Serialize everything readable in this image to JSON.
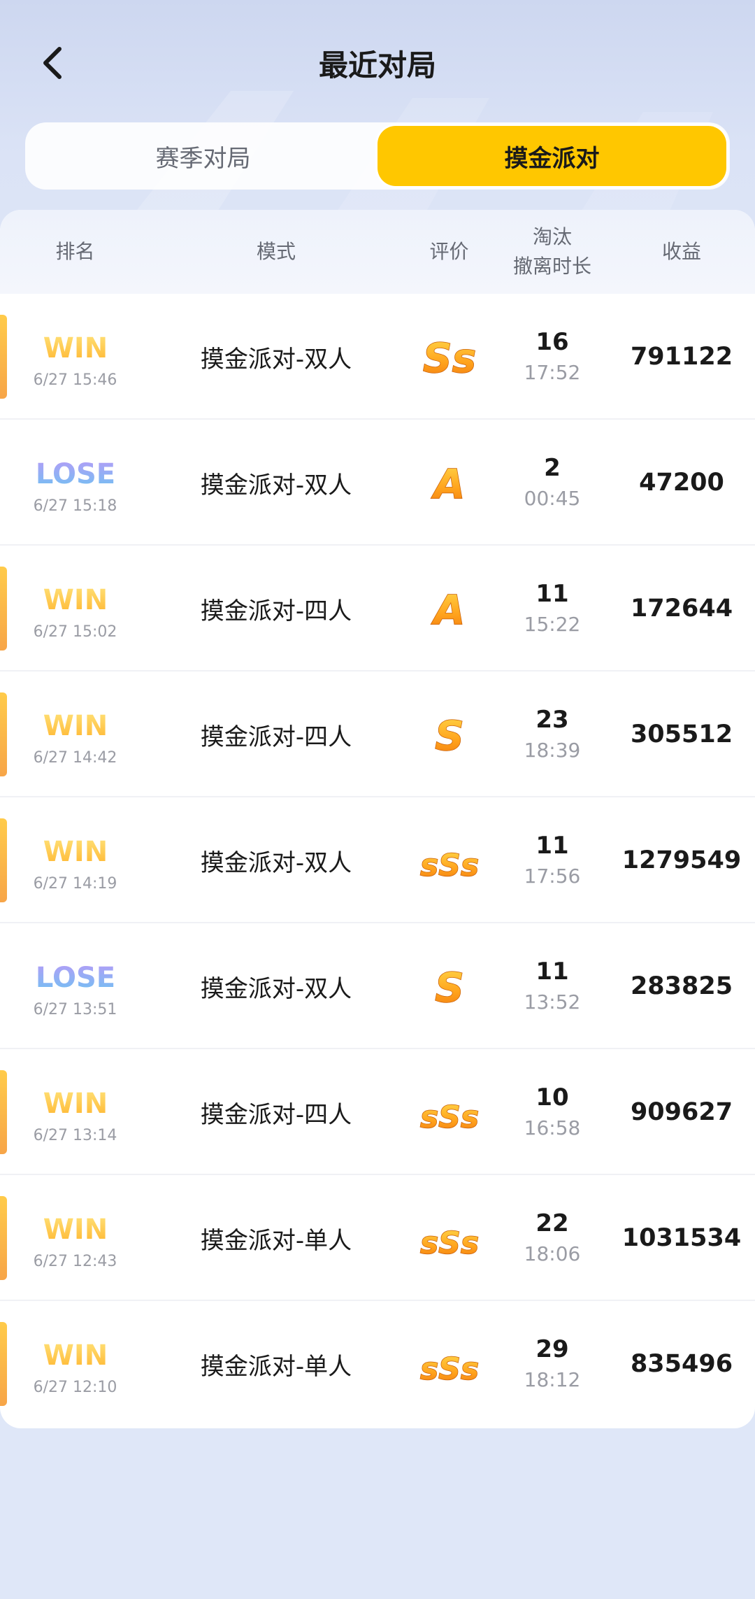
{
  "header": {
    "title": "最近对局",
    "back_icon": "chevron-left-icon"
  },
  "tabs": [
    {
      "label": "赛季对局",
      "active": false
    },
    {
      "label": "摸金派对",
      "active": true
    }
  ],
  "table": {
    "headers": {
      "rank": "排名",
      "mode": "模式",
      "grade": "评价",
      "kills_line1": "淘汰",
      "kills_line2": "撤离时长",
      "income": "收益"
    },
    "rows": [
      {
        "result": "WIN",
        "time": "6/27 15:46",
        "mode": "摸金派对-双人",
        "grade": "Ss",
        "kills": "16",
        "duration": "17:52",
        "income": "791122"
      },
      {
        "result": "LOSE",
        "time": "6/27 15:18",
        "mode": "摸金派对-双人",
        "grade": "A",
        "kills": "2",
        "duration": "00:45",
        "income": "47200"
      },
      {
        "result": "WIN",
        "time": "6/27 15:02",
        "mode": "摸金派对-四人",
        "grade": "A",
        "kills": "11",
        "duration": "15:22",
        "income": "172644"
      },
      {
        "result": "WIN",
        "time": "6/27 14:42",
        "mode": "摸金派对-四人",
        "grade": "S",
        "kills": "23",
        "duration": "18:39",
        "income": "305512"
      },
      {
        "result": "WIN",
        "time": "6/27 14:19",
        "mode": "摸金派对-双人",
        "grade": "sSs",
        "kills": "11",
        "duration": "17:56",
        "income": "1279549"
      },
      {
        "result": "LOSE",
        "time": "6/27 13:51",
        "mode": "摸金派对-双人",
        "grade": "S",
        "kills": "11",
        "duration": "13:52",
        "income": "283825"
      },
      {
        "result": "WIN",
        "time": "6/27 13:14",
        "mode": "摸金派对-四人",
        "grade": "sSs",
        "kills": "10",
        "duration": "16:58",
        "income": "909627"
      },
      {
        "result": "WIN",
        "time": "6/27 12:43",
        "mode": "摸金派对-单人",
        "grade": "sSs",
        "kills": "22",
        "duration": "18:06",
        "income": "1031534"
      },
      {
        "result": "WIN",
        "time": "6/27 12:10",
        "mode": "摸金派对-单人",
        "grade": "sSs",
        "kills": "29",
        "duration": "18:12",
        "income": "835496"
      }
    ]
  },
  "colors": {
    "accent": "#ffc700",
    "win_bar": "#f7a548",
    "win_badge": "#ffc93c",
    "lose_badge": "#9b7cf0"
  }
}
